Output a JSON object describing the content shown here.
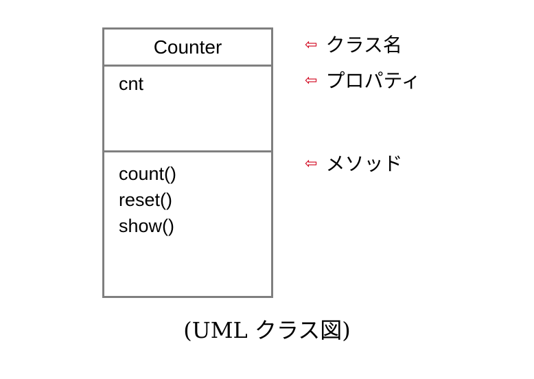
{
  "class_box": {
    "name": "Counter",
    "properties": [
      "cnt"
    ],
    "methods": [
      "count()",
      "reset()",
      "show()"
    ],
    "border_color": "#7f7f7f"
  },
  "annotations": {
    "arrow_glyph": "⇦",
    "arrow_color": "#d0021b",
    "class_name": "クラス名",
    "properties": "プロパティ",
    "methods": "メソッド"
  },
  "caption": "(UML クラス図)"
}
